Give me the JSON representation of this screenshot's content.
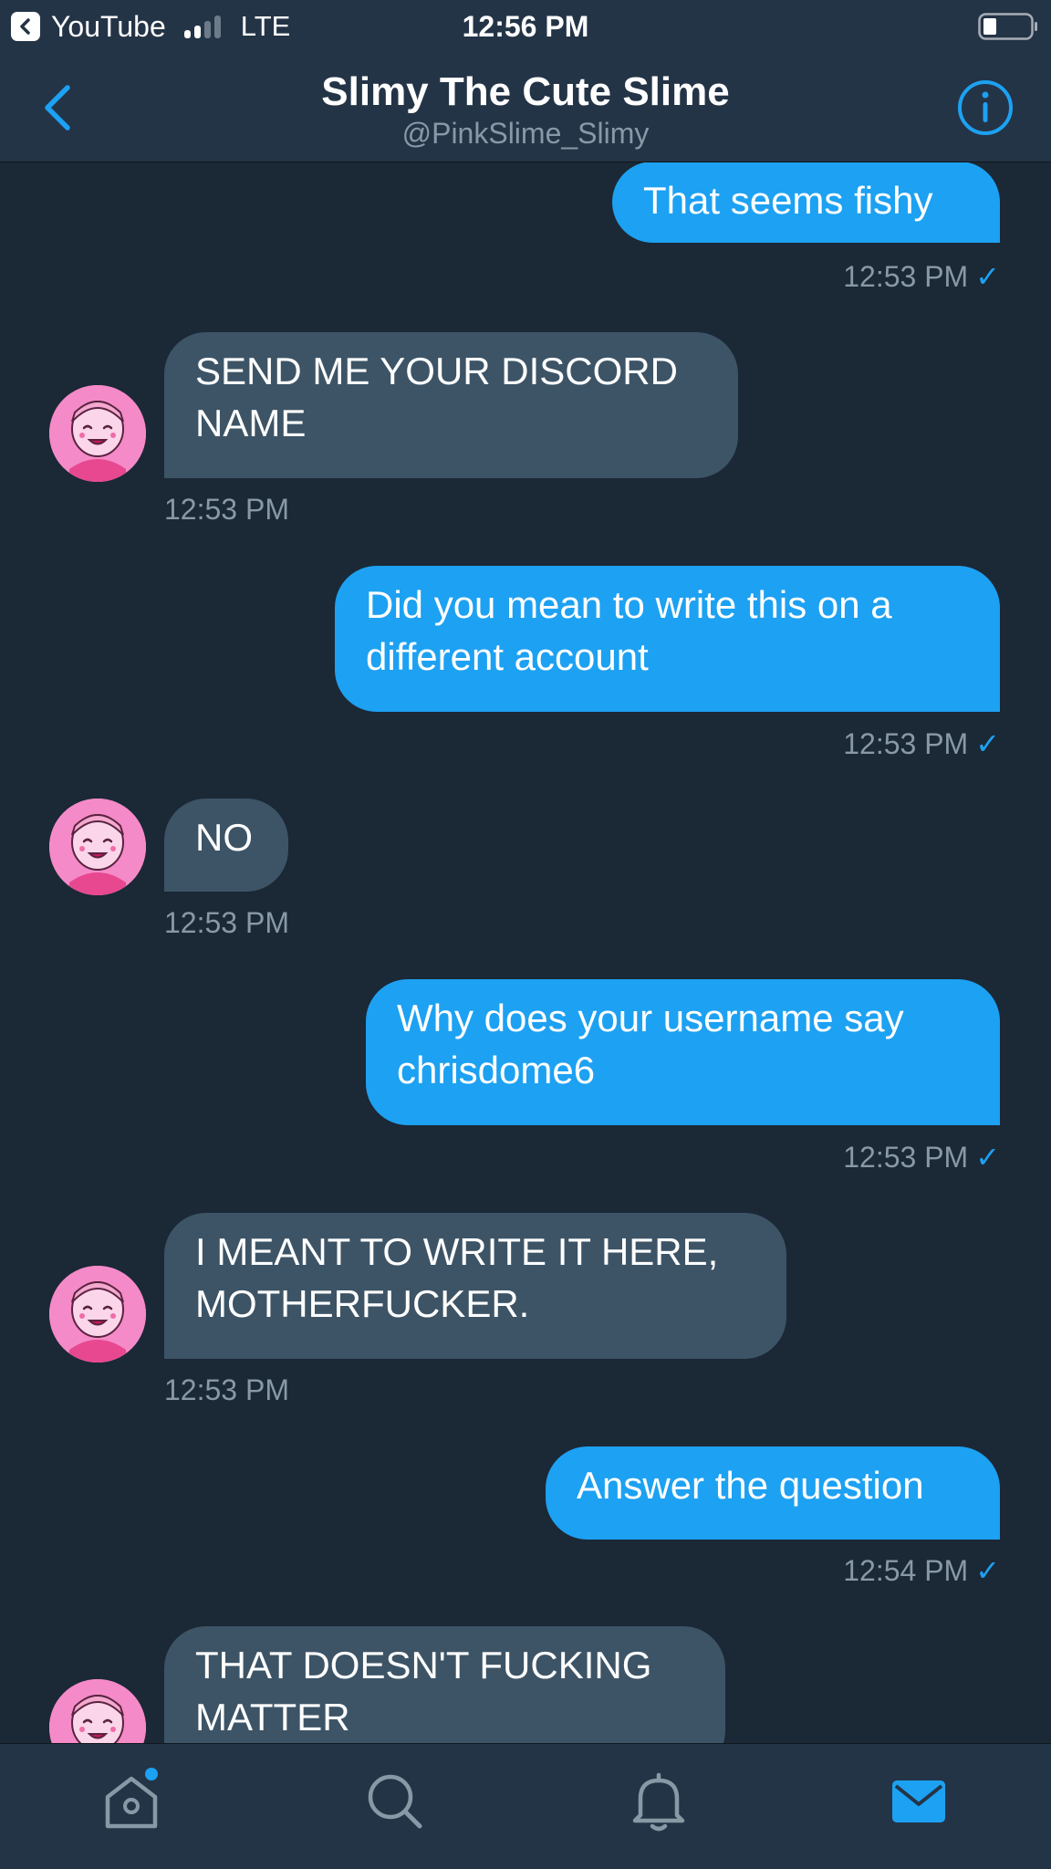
{
  "status_bar": {
    "back_app": "YouTube",
    "carrier": "LTE",
    "time": "12:56 PM"
  },
  "header": {
    "title": "Slimy The Cute Slime",
    "handle": "@PinkSlime_Slimy"
  },
  "colors": {
    "accent": "#1da1f2",
    "background": "#1b2836",
    "bar": "#243447",
    "received_bubble": "#3d5466",
    "muted_text": "#8899a6",
    "avatar_pink": "#f58ac8"
  },
  "messages": [
    {
      "direction": "sent",
      "text": "That seems fishy",
      "time": "12:53 PM",
      "check": "✓"
    },
    {
      "direction": "received",
      "line1": "SEND ME YOUR DISCORD",
      "line2": "NAME",
      "time": "12:53 PM"
    },
    {
      "direction": "sent",
      "line1": "Did you mean to write this on a",
      "line2": "different account",
      "time": "12:53 PM",
      "check": "✓"
    },
    {
      "direction": "received",
      "text": "NO",
      "time": "12:53 PM"
    },
    {
      "direction": "sent",
      "line1": "Why does your username say",
      "line2": "chrisdome6",
      "time": "12:53 PM",
      "check": "✓"
    },
    {
      "direction": "received",
      "line1": "I MEANT TO WRITE IT HERE,",
      "line2": "MOTHERFUCKER.",
      "time": "12:53 PM"
    },
    {
      "direction": "sent",
      "text": "Answer the question",
      "time": "12:54 PM",
      "check": "✓"
    },
    {
      "direction": "received",
      "line1": "THAT DOESN'T FUCKING",
      "line2": "MATTER"
    }
  ],
  "tabs": [
    {
      "icon": "home-icon",
      "badge": true
    },
    {
      "icon": "search-icon"
    },
    {
      "icon": "bell-icon"
    },
    {
      "icon": "mail-icon",
      "active": true
    }
  ]
}
